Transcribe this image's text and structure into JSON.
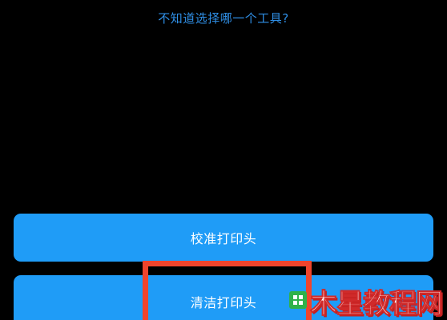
{
  "header": {
    "help_text": "不知道选择哪一个工具?"
  },
  "tools": {
    "calibrate_label": "校准打印头",
    "clean_label": "清洁打印头"
  },
  "watermark": {
    "text": "木星教程网"
  },
  "colors": {
    "background": "#000000",
    "link": "#2f8fe6",
    "button": "#1f9cf7",
    "highlight": "#f0442c",
    "watermark_logo": "#2fb24a"
  }
}
